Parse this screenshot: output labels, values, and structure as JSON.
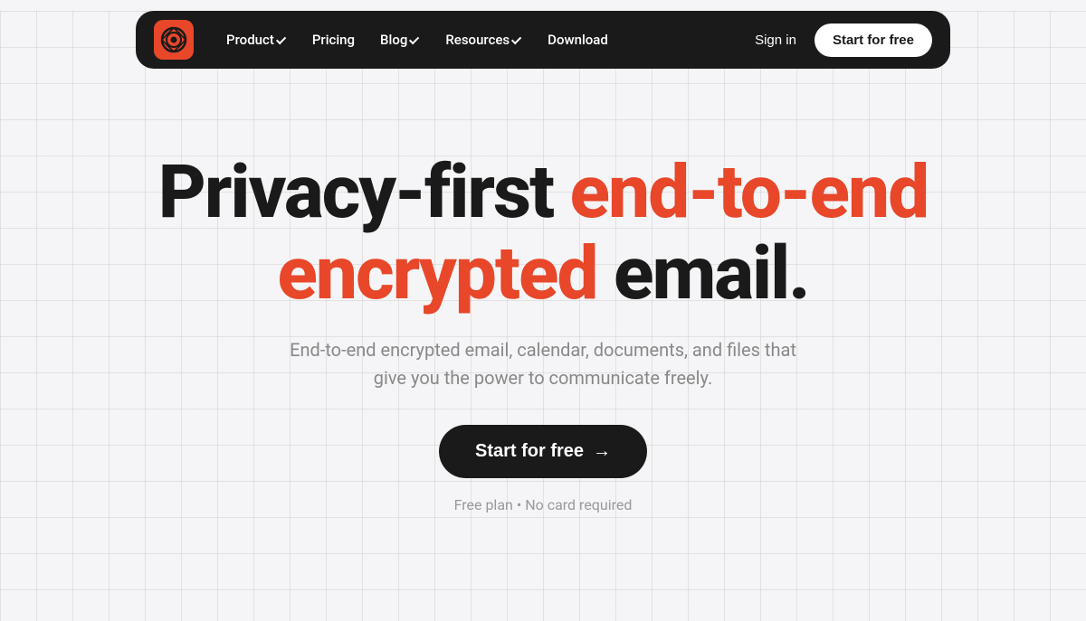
{
  "navbar": {
    "logo_alt": "Skiff logo",
    "nav_items": [
      {
        "label": "Product",
        "has_dropdown": true
      },
      {
        "label": "Pricing",
        "has_dropdown": false
      },
      {
        "label": "Blog",
        "has_dropdown": true
      },
      {
        "label": "Resources",
        "has_dropdown": true
      },
      {
        "label": "Download",
        "has_dropdown": false
      }
    ],
    "sign_in_label": "Sign in",
    "start_free_label": "Start for free"
  },
  "hero": {
    "headline_part1": "Privacy-first ",
    "headline_highlight": "end-to-end",
    "headline_part2": " encrypted ",
    "headline_part3": "email.",
    "subtext": "End-to-end encrypted email, calendar, documents, and files that give you the power to communicate freely.",
    "cta_label": "Start for free",
    "cta_arrow": "→",
    "note": "Free plan • No card required"
  },
  "colors": {
    "accent": "#e8472a",
    "dark": "#1a1a1a",
    "light_text": "#888888",
    "note_text": "#999999"
  }
}
